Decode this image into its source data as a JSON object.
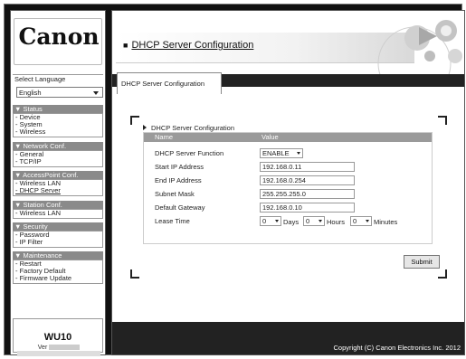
{
  "sidebar": {
    "logo": "Canon",
    "select_language_label": "Select Language",
    "language_value": "English",
    "status": {
      "title": "▼ Status",
      "items": [
        "- Device",
        "- System",
        "- Wireless"
      ]
    },
    "network": {
      "title": "▼ Network Conf.",
      "items": [
        "- General",
        "- TCP/IP"
      ]
    },
    "access_point": {
      "title": "▼ AccessPoint Conf.",
      "items": [
        "- Wireless LAN",
        "- DHCP Server"
      ]
    },
    "station": {
      "title": "▼ Station Conf.",
      "items": [
        "- Wireless LAN"
      ]
    },
    "security": {
      "title": "▼ Security",
      "items": [
        "- Password",
        "- IP Filter"
      ]
    },
    "maintenance": {
      "title": "▼ Maintenance",
      "items": [
        "- Restart",
        "- Factory Default",
        "- Firmware Update"
      ]
    },
    "model": "WU10",
    "version_label": "Ver"
  },
  "header": {
    "title": "DHCP Server Configuration",
    "square": "■"
  },
  "tab": {
    "label": "DHCP Server Configuration"
  },
  "panel": {
    "title": "DHCP Server Configuration",
    "col_name": "Name",
    "col_value": "Value",
    "fields": {
      "function": {
        "label": "DHCP Server Function",
        "value": "ENABLE"
      },
      "start_ip": {
        "label": "Start IP Address",
        "value": "192.168.0.11"
      },
      "end_ip": {
        "label": "End IP Address",
        "value": "192.168.0.254"
      },
      "subnet": {
        "label": "Subnet Mask",
        "value": "255.255.255.0"
      },
      "gateway": {
        "label": "Default Gateway",
        "value": "192.168.0.10"
      },
      "lease": {
        "label": "Lease Time",
        "days": "0",
        "days_unit": "Days",
        "hours": "0",
        "hours_unit": "Hours",
        "minutes": "0",
        "minutes_unit": "Minutes"
      }
    },
    "submit_label": "Submit"
  },
  "footer": {
    "copyright": "Copyright (C) Canon Electronics Inc. 2012"
  }
}
